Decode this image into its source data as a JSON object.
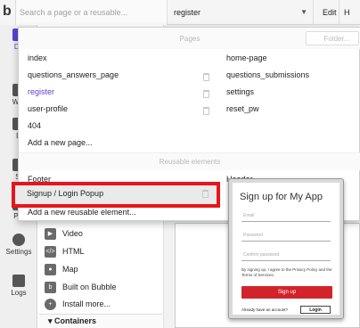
{
  "topbar": {
    "logo": "b",
    "search_placeholder": "Search a page or a reusable...",
    "page_value": "register",
    "caret": "▼",
    "edit_label": "Edit",
    "help_label": "H"
  },
  "left_tools": [
    {
      "label": "De",
      "icon": "design-icon"
    },
    {
      "label": "Wor",
      "icon": "workflow-icon"
    },
    {
      "label": "D",
      "icon": "data-icon"
    },
    {
      "label": "St",
      "icon": "styles-icon"
    },
    {
      "label": "Plu",
      "icon": "plugins-icon"
    },
    {
      "label": "Settings",
      "icon": "settings-icon"
    },
    {
      "label": "Logs",
      "icon": "logs-icon"
    }
  ],
  "palette": {
    "items": [
      {
        "label": "Video",
        "icon": "video-icon",
        "glyph": "▶"
      },
      {
        "label": "HTML",
        "icon": "html-icon",
        "glyph": "</>"
      },
      {
        "label": "Map",
        "icon": "map-icon",
        "glyph": "●"
      },
      {
        "label": "Built on Bubble",
        "icon": "bubble-icon",
        "glyph": "b"
      },
      {
        "label": "Install more...",
        "icon": "install-icon",
        "glyph": "+"
      }
    ],
    "containers_label": "▾ Containers"
  },
  "dropdown": {
    "pages_header": "Pages",
    "folder_placeholder": "Folder...",
    "pages_left": [
      "index",
      "questions_answers_page",
      "register",
      "user-profile",
      "404",
      "Add a new page..."
    ],
    "pages_right": [
      "home-page",
      "questions_submissions",
      "settings",
      "reset_pw"
    ],
    "current_page": "register",
    "reusable_header": "Reusable elements",
    "reusable_left": [
      "Footer",
      "Signup / Login Popup",
      "Add a new reusable element..."
    ],
    "reusable_right": [
      "Header"
    ]
  },
  "preview": {
    "title": "Sign up for My App",
    "email_placeholder": "Email",
    "password_placeholder": "Password",
    "confirm_placeholder": "Confirm password",
    "terms": "By signing up, I agree to the Privacy Policy and the Terms of Services.",
    "signup_button": "Sign up",
    "have_account": "Already have an account?",
    "login_button": "Login"
  },
  "colors": {
    "accent": "#5d3fd3",
    "highlight": "#e8141c",
    "signup_button": "#d2232a"
  }
}
